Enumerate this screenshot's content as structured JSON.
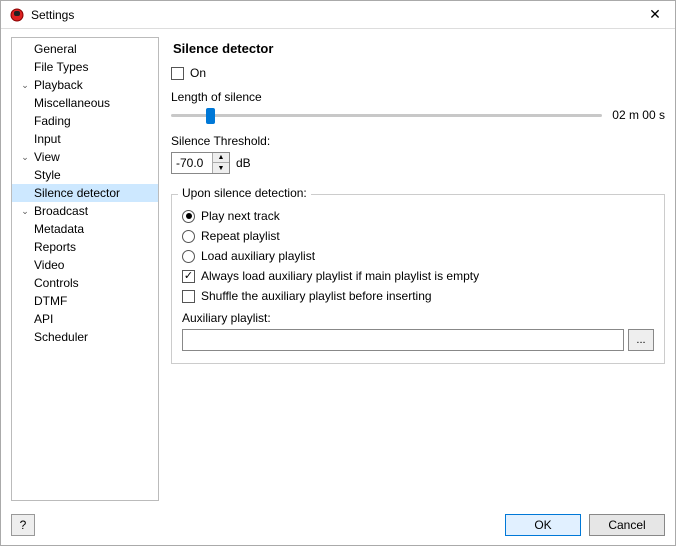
{
  "window": {
    "title": "Settings",
    "close_label": "✕"
  },
  "sidebar": {
    "items": [
      {
        "label": "General",
        "level": 0,
        "expandable": false
      },
      {
        "label": "File Types",
        "level": 0,
        "expandable": false
      },
      {
        "label": "Playback",
        "level": 0,
        "expandable": true,
        "expanded": true
      },
      {
        "label": "Miscellaneous",
        "level": 1
      },
      {
        "label": "Fading",
        "level": 1
      },
      {
        "label": "Input",
        "level": 0,
        "expandable": false
      },
      {
        "label": "View",
        "level": 0,
        "expandable": true,
        "expanded": true
      },
      {
        "label": "Style",
        "level": 1
      },
      {
        "label": "Silence detector",
        "level": 0,
        "expandable": false,
        "selected": true
      },
      {
        "label": "Broadcast",
        "level": 0,
        "expandable": true,
        "expanded": true
      },
      {
        "label": "Metadata",
        "level": 1
      },
      {
        "label": "Reports",
        "level": 0,
        "expandable": false
      },
      {
        "label": "Video",
        "level": 0,
        "expandable": false
      },
      {
        "label": "Controls",
        "level": 0,
        "expandable": false
      },
      {
        "label": "DTMF",
        "level": 0,
        "expandable": false
      },
      {
        "label": "API",
        "level": 0,
        "expandable": false
      },
      {
        "label": "Scheduler",
        "level": 0,
        "expandable": false
      }
    ]
  },
  "main": {
    "title": "Silence detector",
    "on_label": "On",
    "on_checked": false,
    "length_label": "Length of silence",
    "length_value": "02 m 00 s",
    "threshold_label": "Silence Threshold:",
    "threshold_value": "-70.0",
    "threshold_unit": "dB",
    "group_title": "Upon silence detection:",
    "radios": [
      {
        "label": "Play next track",
        "checked": true
      },
      {
        "label": "Repeat playlist",
        "checked": false
      },
      {
        "label": "Load auxiliary playlist",
        "checked": false
      }
    ],
    "checks": [
      {
        "label": "Always load auxiliary playlist if main playlist is empty",
        "checked": true
      },
      {
        "label": "Shuffle the auxiliary playlist before inserting",
        "checked": false
      }
    ],
    "aux_label": "Auxiliary playlist:",
    "aux_value": "",
    "browse_label": "..."
  },
  "footer": {
    "help_label": "?",
    "ok_label": "OK",
    "cancel_label": "Cancel"
  }
}
